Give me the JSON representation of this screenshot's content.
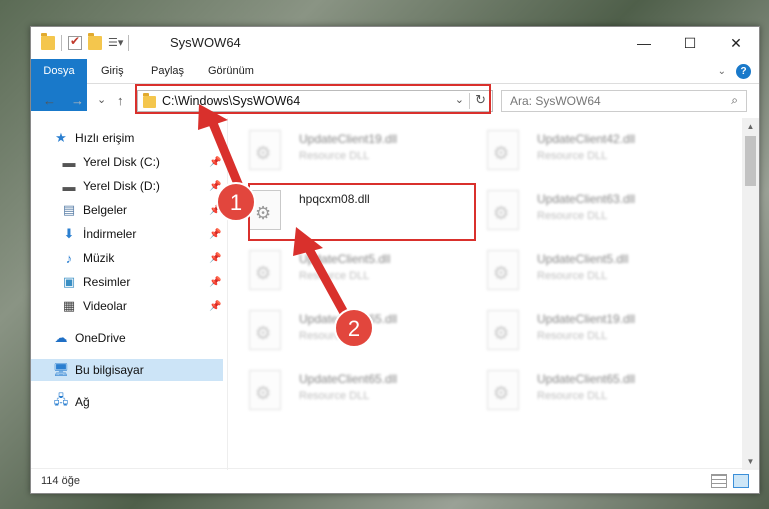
{
  "window": {
    "title": "SysWOW64",
    "controls": {
      "minimize": "—",
      "maximize": "☐",
      "close": "✕"
    }
  },
  "ribbon": {
    "tabs": [
      "Dosya",
      "Giriş",
      "Paylaş",
      "Görünüm"
    ],
    "accent": "#1979ca"
  },
  "nav": {
    "back": "←",
    "forward": "→",
    "recent": "⌄",
    "up": "↑",
    "address": "C:\\Windows\\SysWOW64",
    "search_placeholder": "Ara: SysWOW64"
  },
  "sidebar": {
    "items": [
      {
        "label": "Hızlı erişim",
        "icon": "star-icon",
        "pinned": false
      },
      {
        "label": "Yerel Disk (C:)",
        "icon": "drive-icon",
        "pinned": true
      },
      {
        "label": "Yerel Disk (D:)",
        "icon": "drive-icon",
        "pinned": true
      },
      {
        "label": "Belgeler",
        "icon": "document-icon",
        "pinned": true
      },
      {
        "label": "İndirmeler",
        "icon": "download-icon",
        "pinned": true
      },
      {
        "label": "Müzik",
        "icon": "music-icon",
        "pinned": true
      },
      {
        "label": "Resimler",
        "icon": "pictures-icon",
        "pinned": true
      },
      {
        "label": "Videolar",
        "icon": "video-icon",
        "pinned": true
      },
      {
        "label": "OneDrive",
        "icon": "cloud-icon",
        "pinned": false
      },
      {
        "label": "Bu bilgisayar",
        "icon": "computer-icon",
        "pinned": false,
        "selected": true
      },
      {
        "label": "Ağ",
        "icon": "network-icon",
        "pinned": false
      }
    ]
  },
  "files": [
    {
      "name": "UpdateClient19.dll",
      "type": "Resource DLL",
      "blurred": true
    },
    {
      "name": "UpdateClient42.dll",
      "type": "Resource DLL",
      "blurred": true
    },
    {
      "name": "hpqcxm08.dll",
      "type": "",
      "blurred": false,
      "highlighted": true
    },
    {
      "name": "UpdateClient63.dll",
      "type": "Resource DLL",
      "blurred": true
    },
    {
      "name": "UpdateClient5.dll",
      "type": "Resource DLL",
      "blurred": true
    },
    {
      "name": "UpdateClient5.dll",
      "type": "Resource DLL",
      "blurred": true
    },
    {
      "name": "UpdateClient65.dll",
      "type": "Resource DLL",
      "blurred": true
    },
    {
      "name": "UpdateClient19.dll",
      "type": "Resource DLL",
      "blurred": true
    },
    {
      "name": "UpdateClient65.dll",
      "type": "Resource DLL",
      "blurred": true
    },
    {
      "name": "UpdateClient65.dll",
      "type": "Resource DLL",
      "blurred": true
    }
  ],
  "annotations": {
    "step1": "1",
    "step2": "2",
    "color": "#d9302c"
  },
  "status": {
    "count": "114 öğe"
  }
}
